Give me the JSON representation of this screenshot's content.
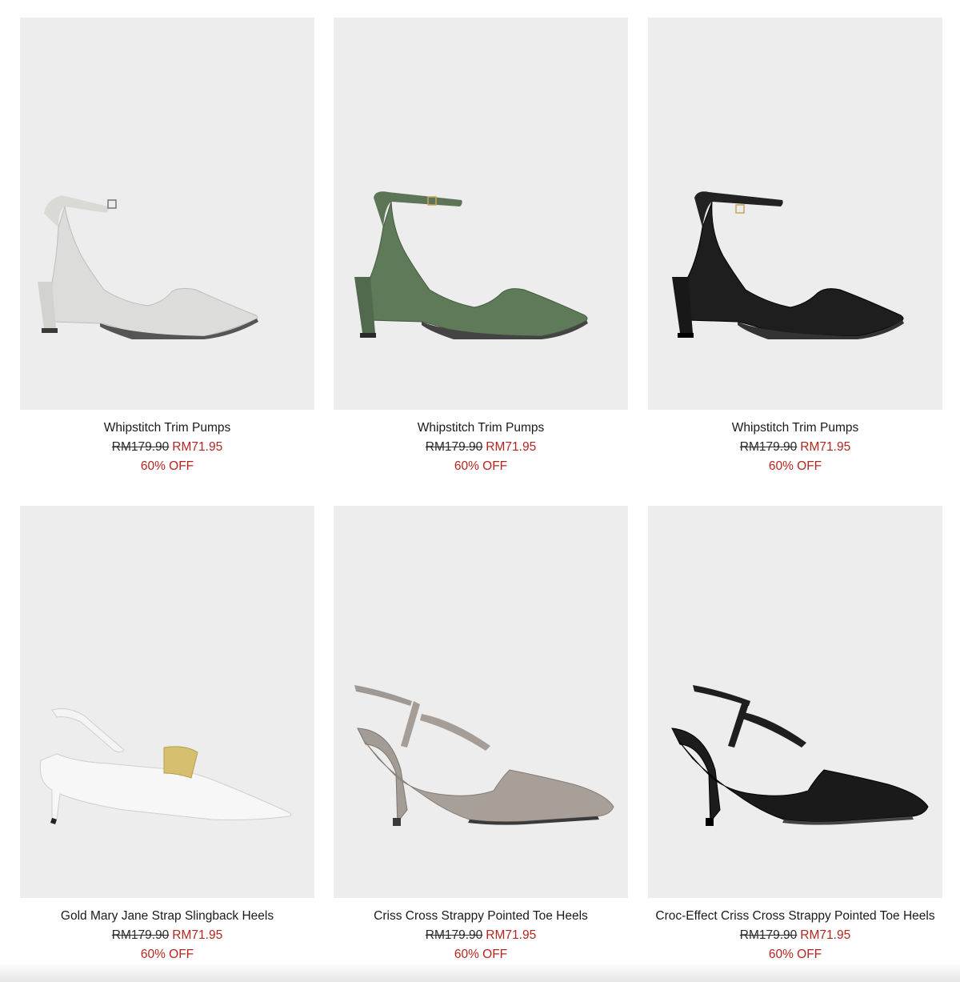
{
  "colors": {
    "image_bg": "#ededed",
    "sale_red": "#b3261e",
    "text": "#1a1a1a"
  },
  "products": [
    {
      "name": "Whipstitch Trim Pumps",
      "original_price": "RM179.90",
      "sale_price": "RM71.95",
      "discount": "60% OFF",
      "color": "chalk"
    },
    {
      "name": "Whipstitch Trim Pumps",
      "original_price": "RM179.90",
      "sale_price": "RM71.95",
      "discount": "60% OFF",
      "color": "green"
    },
    {
      "name": "Whipstitch Trim Pumps",
      "original_price": "RM179.90",
      "sale_price": "RM71.95",
      "discount": "60% OFF",
      "color": "black"
    },
    {
      "name": "Gold Mary Jane Strap Slingback Heels",
      "original_price": "RM179.90",
      "sale_price": "RM71.95",
      "discount": "60% OFF",
      "color": "white"
    },
    {
      "name": "Criss Cross Strappy Pointed Toe Heels",
      "original_price": "RM179.90",
      "sale_price": "RM71.95",
      "discount": "60% OFF",
      "color": "taupe"
    },
    {
      "name": "Croc-Effect Criss Cross Strappy Pointed Toe Heels",
      "original_price": "RM179.90",
      "sale_price": "RM71.95",
      "discount": "60% OFF",
      "color": "black"
    }
  ]
}
